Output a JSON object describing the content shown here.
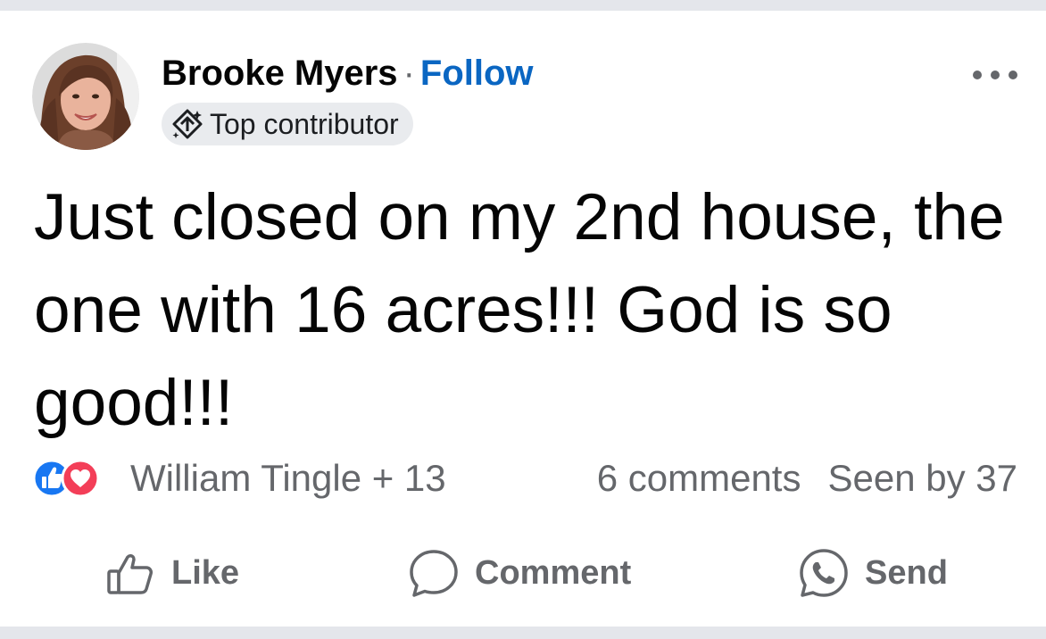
{
  "post": {
    "author": {
      "name": "Brooke Myers",
      "separator": "·",
      "follow_label": "Follow",
      "badge_label": "Top contributor",
      "avatar_icon": "profile-photo"
    },
    "more_icon": "more-horizontal-icon",
    "text": "Just closed on my 2nd house, the one with 16 acres!!! God is so good!!!",
    "reactions": {
      "icons": [
        "like-reaction-icon",
        "love-reaction-icon"
      ],
      "summary": "William Tingle + 13"
    },
    "stats": {
      "comments": "6 comments",
      "seen": "Seen by 37"
    },
    "actions": {
      "like_label": "Like",
      "comment_label": "Comment",
      "send_label": "Send"
    }
  },
  "colors": {
    "follow": "#0a66c2",
    "like_reaction": "#1877f2",
    "love_reaction": "#f33e58",
    "secondary_text": "#65676b",
    "page_background": "#e4e6eb"
  }
}
